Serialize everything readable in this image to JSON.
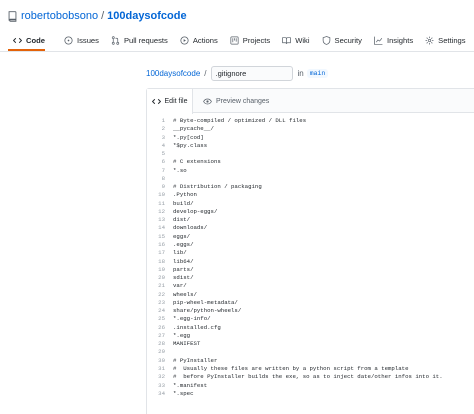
{
  "repo": {
    "owner": "robertobobsono",
    "separator": "/",
    "name": "100daysofcode"
  },
  "tabs": [
    {
      "label": "Code",
      "icon": "code-icon",
      "active": true
    },
    {
      "label": "Issues",
      "icon": "issue-icon"
    },
    {
      "label": "Pull requests",
      "icon": "pull-request-icon"
    },
    {
      "label": "Actions",
      "icon": "play-icon"
    },
    {
      "label": "Projects",
      "icon": "project-icon"
    },
    {
      "label": "Wiki",
      "icon": "book-icon"
    },
    {
      "label": "Security",
      "icon": "shield-icon"
    },
    {
      "label": "Insights",
      "icon": "graph-icon"
    },
    {
      "label": "Settings",
      "icon": "gear-icon"
    }
  ],
  "path": {
    "repo_link": "100daysofcode",
    "separator": "/",
    "filename": ".gitignore",
    "in_label": "in",
    "branch": "main"
  },
  "editor": {
    "edit_tab_label": "Edit file",
    "preview_tab_label": "Preview changes",
    "lines": [
      "# Byte-compiled / optimized / DLL files",
      "__pycache__/",
      "*.py[cod]",
      "*$py.class",
      "",
      "# C extensions",
      "*.so",
      "",
      "# Distribution / packaging",
      ".Python",
      "build/",
      "develop-eggs/",
      "dist/",
      "downloads/",
      "eggs/",
      ".eggs/",
      "lib/",
      "lib64/",
      "parts/",
      "sdist/",
      "var/",
      "wheels/",
      "pip-wheel-metadata/",
      "share/python-wheels/",
      "*.egg-info/",
      ".installed.cfg",
      "*.egg",
      "MANIFEST",
      "",
      "# PyInstaller",
      "#  Usually these files are written by a python script from a template",
      "#  before PyInstaller builds the exe, so as to inject date/other infos into it.",
      "*.manifest",
      "*.spec"
    ]
  },
  "colors": {
    "link": "#0366d6",
    "tab_underline": "#e36209",
    "border": "#e1e4e8"
  }
}
